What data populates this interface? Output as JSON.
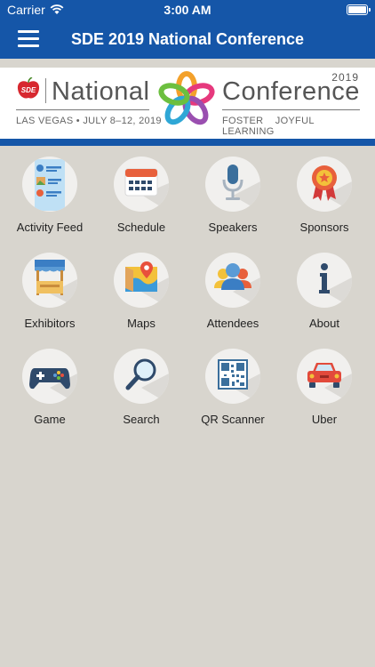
{
  "status": {
    "carrier": "Carrier",
    "time": "3:00 AM"
  },
  "nav": {
    "title": "SDE 2019 National Conference"
  },
  "banner": {
    "brand": "SDE",
    "word_left": "National",
    "word_right": "Conference",
    "year": "2019",
    "location": "LAS VEGAS  •  JULY 8–12, 2019",
    "tagline": "FOSTER JOYFUL LEARNING"
  },
  "tiles": [
    {
      "label": "Activity Feed",
      "icon": "activity-feed-icon"
    },
    {
      "label": "Schedule",
      "icon": "calendar-icon"
    },
    {
      "label": "Speakers",
      "icon": "microphone-icon"
    },
    {
      "label": "Sponsors",
      "icon": "award-ribbon-icon"
    },
    {
      "label": "Exhibitors",
      "icon": "booth-icon"
    },
    {
      "label": "Maps",
      "icon": "map-pin-icon"
    },
    {
      "label": "Attendees",
      "icon": "people-icon"
    },
    {
      "label": "About",
      "icon": "info-icon"
    },
    {
      "label": "Game",
      "icon": "gamepad-icon"
    },
    {
      "label": "Search",
      "icon": "magnifier-icon"
    },
    {
      "label": "QR Scanner",
      "icon": "qr-code-icon"
    },
    {
      "label": "Uber",
      "icon": "car-icon"
    }
  ],
  "colors": {
    "nav_blue": "#1556a8",
    "background": "#d8d5ce",
    "tile_circle": "#f1f0ee"
  }
}
